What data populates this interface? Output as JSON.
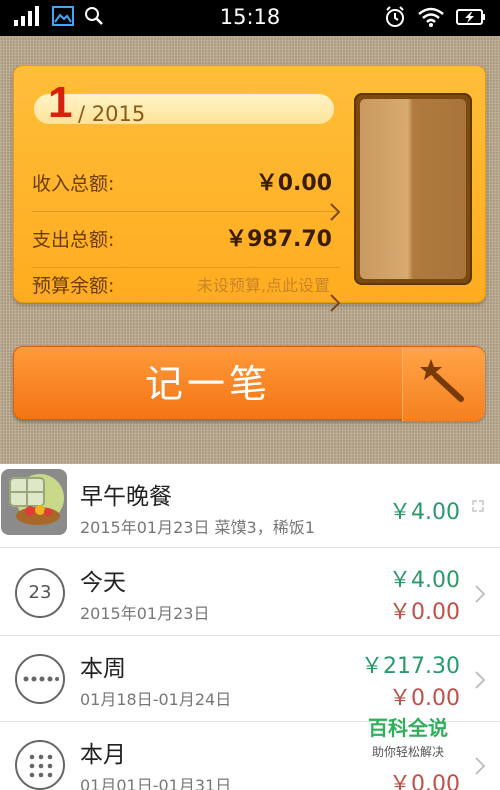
{
  "status_bar": {
    "time": "15:18"
  },
  "summary": {
    "month": "1",
    "year": "/ 2015",
    "income_label": "收入总额:",
    "income_value": "￥0.00",
    "expense_label": "支出总额:",
    "expense_value": "￥987.70",
    "budget_label": "预算余额:",
    "budget_hint": "未设预算,点此设置"
  },
  "record_button": {
    "label": "记一笔"
  },
  "list": [
    {
      "title": "早午晚餐",
      "subtitle": "2015年01月23日 菜馍3，稀饭1",
      "amount": "￥4.00"
    },
    {
      "title": "今天",
      "icon_text": "23",
      "subtitle": "2015年01月23日",
      "income": "￥4.00",
      "expense": "￥0.00"
    },
    {
      "title": "本周",
      "subtitle": "01月18日-01月24日",
      "income": "￥217.30",
      "expense": "￥0.00"
    },
    {
      "title": "本月",
      "subtitle": "01月01日-01月31日",
      "expense": "￥0.00"
    }
  ],
  "watermark": {
    "main": "百科全说",
    "sub": "助你轻松解决"
  },
  "colors": {
    "income_green": "#2a9a6a",
    "expense_red": "#c0504a",
    "accent_orange": "#f47414"
  }
}
